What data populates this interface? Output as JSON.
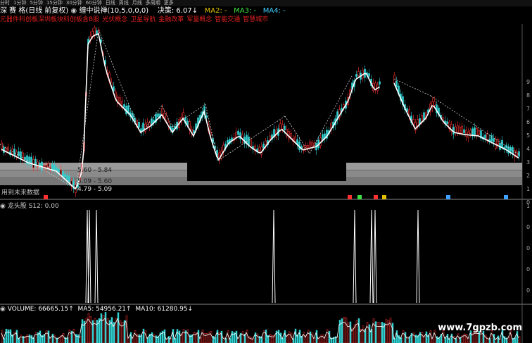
{
  "toolbar": {
    "periods": [
      "分时",
      "1分钟",
      "5分钟",
      "15分钟",
      "30分钟",
      "60分钟",
      "日线",
      "周线",
      "月线",
      "多周期",
      "更多"
    ]
  },
  "title": {
    "name": "深 赛 格(日线 前复权)",
    "indicator": "缠中说禅(10,5,0,0,0)",
    "decision": "决策: 6.07↓",
    "ma2": "MA2: -",
    "ma3": "MA3: -",
    "ma4": "MA4: -"
  },
  "concepts": [
    "元器件科创板深圳板块科创板含B股",
    "光伏概念",
    "卫星导航",
    "金融改革",
    "军量概念",
    "智能交通",
    "智慧城市"
  ],
  "price_panel": {
    "band_labels": [
      "5.60 - 5.84",
      "5.09 - 5.60",
      "4.79 - 5.09"
    ],
    "low_label": "4.79",
    "future_text": "用到未来数据",
    "right_ticks": [
      "9",
      "8",
      "7",
      "6",
      "5",
      "4",
      "3",
      "2",
      "1",
      "0"
    ]
  },
  "signal_panel": {
    "title": "龙头股 S12: 0.00",
    "right_ticks": [
      "1",
      "0",
      "0",
      "0",
      "0"
    ]
  },
  "volume_panel": {
    "volume": "VOLUME: 66665.15↑",
    "ma5": "MA5: 54956.21↑",
    "ma10": "MA10: 61280.95↓"
  },
  "watermark": "www.7gpzb.com",
  "colors": {
    "up": "#ff3030",
    "down": "#30d0d0",
    "ma": "#ffffff",
    "yellow": "#e0c000",
    "green": "#40e040",
    "cyan": "#40d0ff"
  }
}
